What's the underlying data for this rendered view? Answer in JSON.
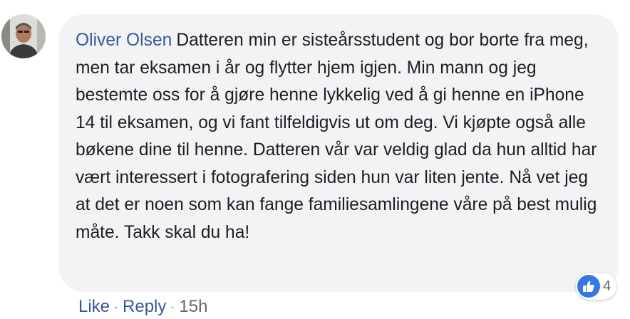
{
  "comment": {
    "author": "Oliver Olsen",
    "text": "Datteren min er sisteårsstudent og bor borte fra meg, men tar eksamen i år og flytter hjem igjen. Min mann og jeg bestemte oss for å gjøre henne lykkelig ved å gi henne en iPhone 14 til eksamen, og vi fant tilfeldigvis ut om deg. Vi kjøpte også alle bøkene dine til henne. Datteren vår var veldig glad da hun alltid har vært interessert i fotografering siden hun var liten jente. Nå vet jeg at det er noen som kan fange familiesamlingene våre på best mulig måte. Takk skal du ha!",
    "reaction_icon": "like-thumbs-up-icon",
    "reaction_count": "4",
    "actions": {
      "like": "Like",
      "reply": "Reply",
      "separator": "·",
      "timestamp": "15h"
    }
  },
  "colors": {
    "author": "#385898",
    "bubble": "#f2f3f5",
    "like_badge": "#3578e5",
    "meta": "#606770"
  }
}
